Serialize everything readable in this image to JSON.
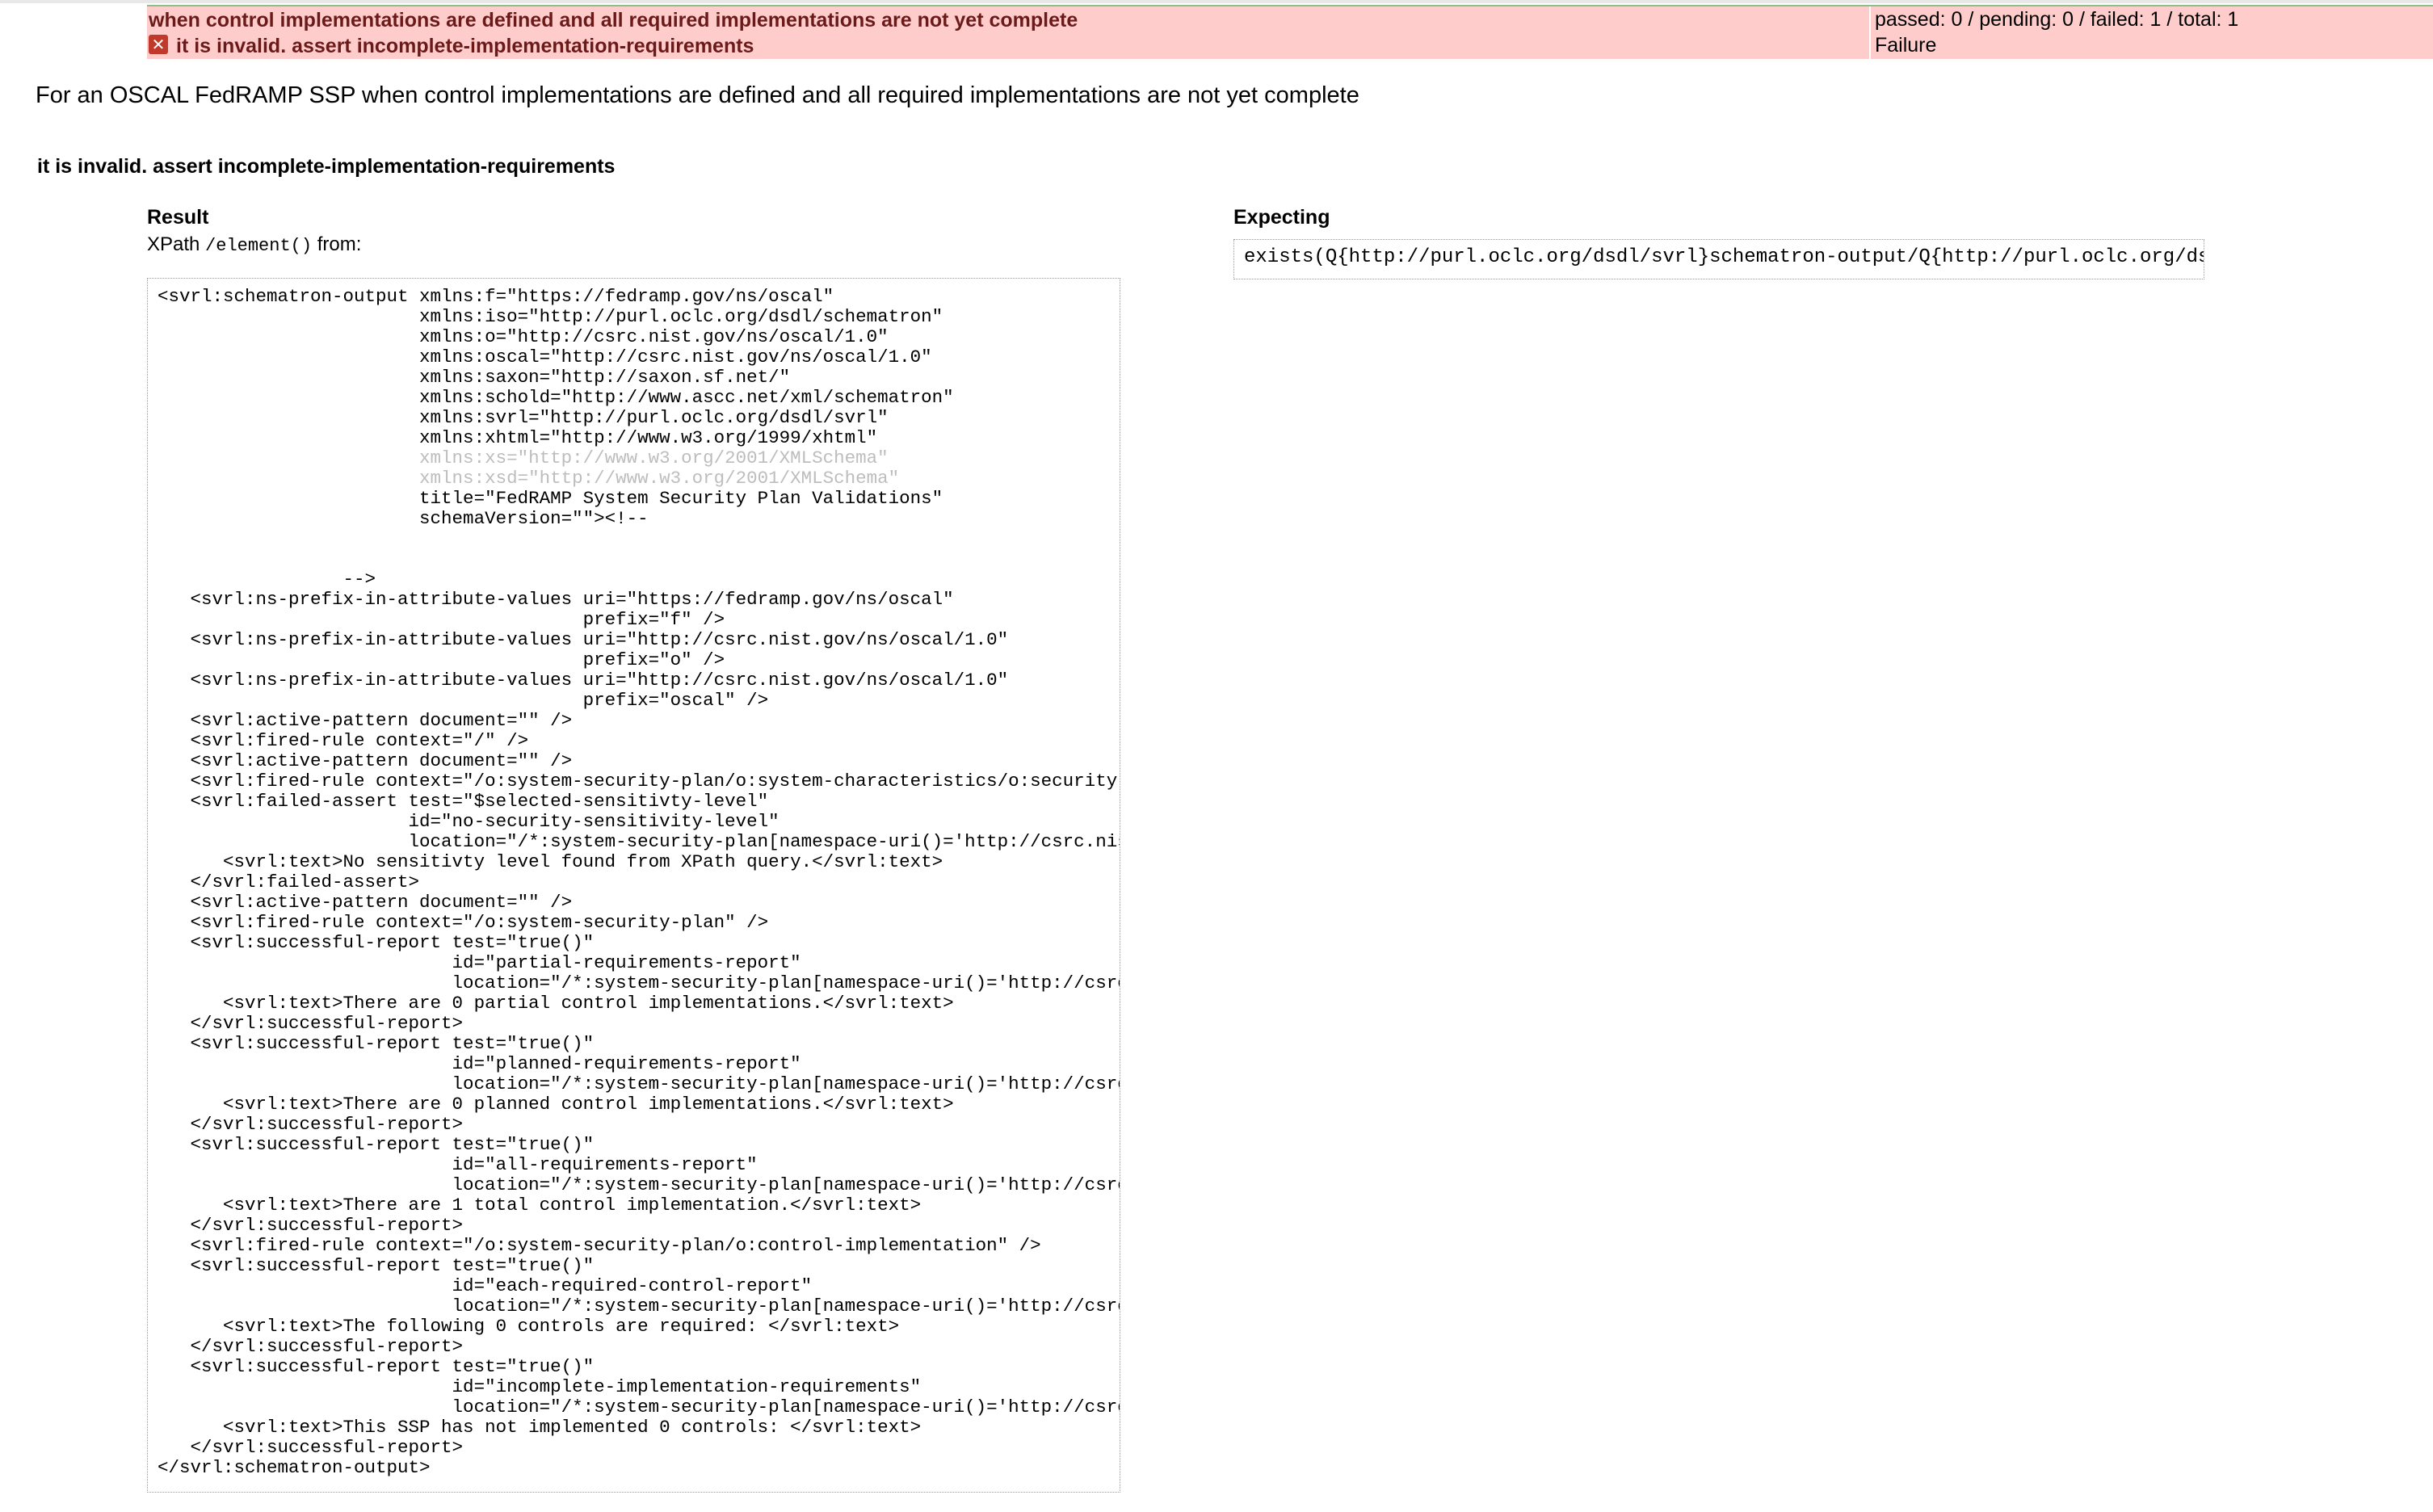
{
  "header": {
    "scenario_label": "when control implementations are defined and all required implementations are not yet complete",
    "scenario_stats": "passed: 0 / pending: 0 / failed: 1 / total: 1",
    "test_label": "it is invalid. assert incomplete-implementation-requirements",
    "test_status": "Failure",
    "fail_icon": "x-icon"
  },
  "scenario_title": "For an OSCAL FedRAMP SSP when control implementations are defined and all required implementations are not yet complete",
  "test_heading": "it is invalid. assert incomplete-implementation-requirements",
  "result": {
    "label": "Result",
    "xpath_prefix": "XPath ",
    "xpath_code": "/element()",
    "xpath_suffix": " from:",
    "lines_before_dim": "<svrl:schematron-output xmlns:f=\"https://fedramp.gov/ns/oscal\"\n                        xmlns:iso=\"http://purl.oclc.org/dsdl/schematron\"\n                        xmlns:o=\"http://csrc.nist.gov/ns/oscal/1.0\"\n                        xmlns:oscal=\"http://csrc.nist.gov/ns/oscal/1.0\"\n                        xmlns:saxon=\"http://saxon.sf.net/\"\n                        xmlns:schold=\"http://www.ascc.net/xml/schematron\"\n                        xmlns:svrl=\"http://purl.oclc.org/dsdl/svrl\"\n                        xmlns:xhtml=\"http://www.w3.org/1999/xhtml\"",
    "lines_dim": "                        xmlns:xs=\"http://www.w3.org/2001/XMLSchema\"\n                        xmlns:xsd=\"http://www.w3.org/2001/XMLSchema\"",
    "lines_after_dim": "                        title=\"FedRAMP System Security Plan Validations\"\n                        schemaVersion=\"\"><!--\n\n\n                 -->\n   <svrl:ns-prefix-in-attribute-values uri=\"https://fedramp.gov/ns/oscal\"\n                                       prefix=\"f\" />\n   <svrl:ns-prefix-in-attribute-values uri=\"http://csrc.nist.gov/ns/oscal/1.0\"\n                                       prefix=\"o\" />\n   <svrl:ns-prefix-in-attribute-values uri=\"http://csrc.nist.gov/ns/oscal/1.0\"\n                                       prefix=\"oscal\" />\n   <svrl:active-pattern document=\"\" />\n   <svrl:fired-rule context=\"/\" />\n   <svrl:active-pattern document=\"\" />\n   <svrl:fired-rule context=\"/o:system-security-plan/o:system-characteristics/o:security-sensitivity-level\" />\n   <svrl:failed-assert test=\"$selected-sensitivty-level\"\n                       id=\"no-security-sensitivity-level\"\n                       location=\"/*:system-security-plan[namespace-uri()='http://csrc.nist.gov/ns/oscal/1.0'][1]\">\n      <svrl:text>No sensitivty level found from XPath query.</svrl:text>\n   </svrl:failed-assert>\n   <svrl:active-pattern document=\"\" />\n   <svrl:fired-rule context=\"/o:system-security-plan\" />\n   <svrl:successful-report test=\"true()\"\n                           id=\"partial-requirements-report\"\n                           location=\"/*:system-security-plan[namespace-uri()='http://csrc.nist.gov/ns/oscal/1.0'][1]\">\n      <svrl:text>There are 0 partial control implementations.</svrl:text>\n   </svrl:successful-report>\n   <svrl:successful-report test=\"true()\"\n                           id=\"planned-requirements-report\"\n                           location=\"/*:system-security-plan[namespace-uri()='http://csrc.nist.gov/ns/oscal/1.0'][1]\">\n      <svrl:text>There are 0 planned control implementations.</svrl:text>\n   </svrl:successful-report>\n   <svrl:successful-report test=\"true()\"\n                           id=\"all-requirements-report\"\n                           location=\"/*:system-security-plan[namespace-uri()='http://csrc.nist.gov/ns/oscal/1.0'][1]\">\n      <svrl:text>There are 1 total control implementation.</svrl:text>\n   </svrl:successful-report>\n   <svrl:fired-rule context=\"/o:system-security-plan/o:control-implementation\" />\n   <svrl:successful-report test=\"true()\"\n                           id=\"each-required-control-report\"\n                           location=\"/*:system-security-plan[namespace-uri()='http://csrc.nist.gov/ns/oscal/1.0'][1]\">\n      <svrl:text>The following 0 controls are required: </svrl:text>\n   </svrl:successful-report>\n   <svrl:successful-report test=\"true()\"\n                           id=\"incomplete-implementation-requirements\"\n                           location=\"/*:system-security-plan[namespace-uri()='http://csrc.nist.gov/ns/oscal/1.0'][1]\">\n      <svrl:text>This SSP has not implemented 0 controls: </svrl:text>\n   </svrl:successful-report>\n</svrl:schematron-output>"
  },
  "expecting": {
    "label": "Expecting",
    "code": "exists(Q{http://purl.oclc.org/dsdl/svrl}schematron-output/Q{http://purl.oclc.org/dsdl/svrl}successful-report[@id = 'incomplete-implementation-requirements'])"
  }
}
